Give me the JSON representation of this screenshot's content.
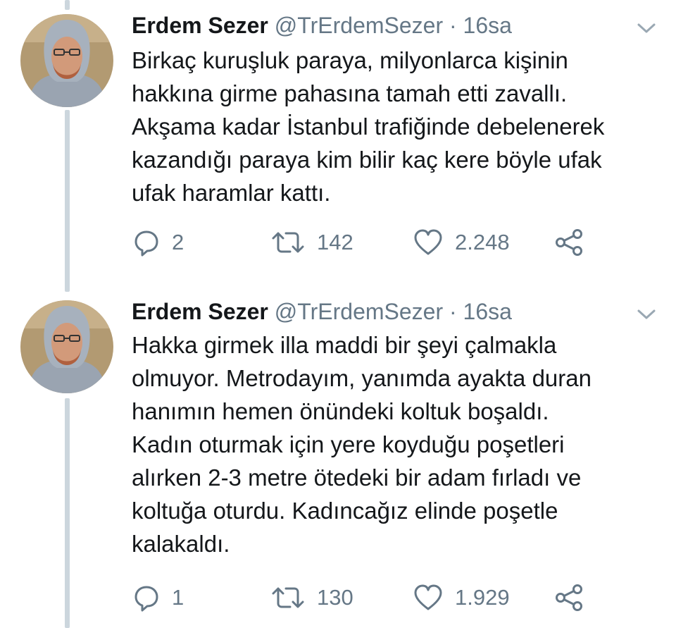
{
  "tweets": [
    {
      "name": "Erdem Sezer",
      "handle": "@TrErdemSezer",
      "separator": "·",
      "time": "16sa",
      "text": "Birkaç kuruşluk paraya, milyonlarca kişinin\nhakkına girme pahasına tamah etti zavallı.\nAkşama kadar İstanbul trafiğinde debelenerek\nkazandığı paraya kim bilir kaç kere böyle ufak\nufak haramlar kattı.",
      "replies": "2",
      "retweets": "142",
      "likes": "2.248"
    },
    {
      "name": "Erdem Sezer",
      "handle": "@TrErdemSezer",
      "separator": "·",
      "time": "16sa",
      "text": "Hakka girmek illa maddi bir şeyi çalmakla\nolmuyor. Metrodayım, yanımda ayakta duran\nhanımın hemen önündeki koltuk boşaldı.\nKadın  oturmak için yere koyduğu poşetleri\nalırken 2-3 metre ötedeki bir adam fırladı ve\nkoltuğa oturdu. Kadıncağız elinde poşetle\nkalakaldı.",
      "replies": "1",
      "retweets": "130",
      "likes": "1.929"
    }
  ],
  "icons": {
    "reply": "reply-icon",
    "retweet": "retweet-icon",
    "like": "heart-icon",
    "share": "share-icon",
    "caret": "chevron-down-icon"
  },
  "colors": {
    "text": "#14171a",
    "secondary": "#657786",
    "thread_line": "#ccd6dd",
    "background": "#ffffff"
  }
}
